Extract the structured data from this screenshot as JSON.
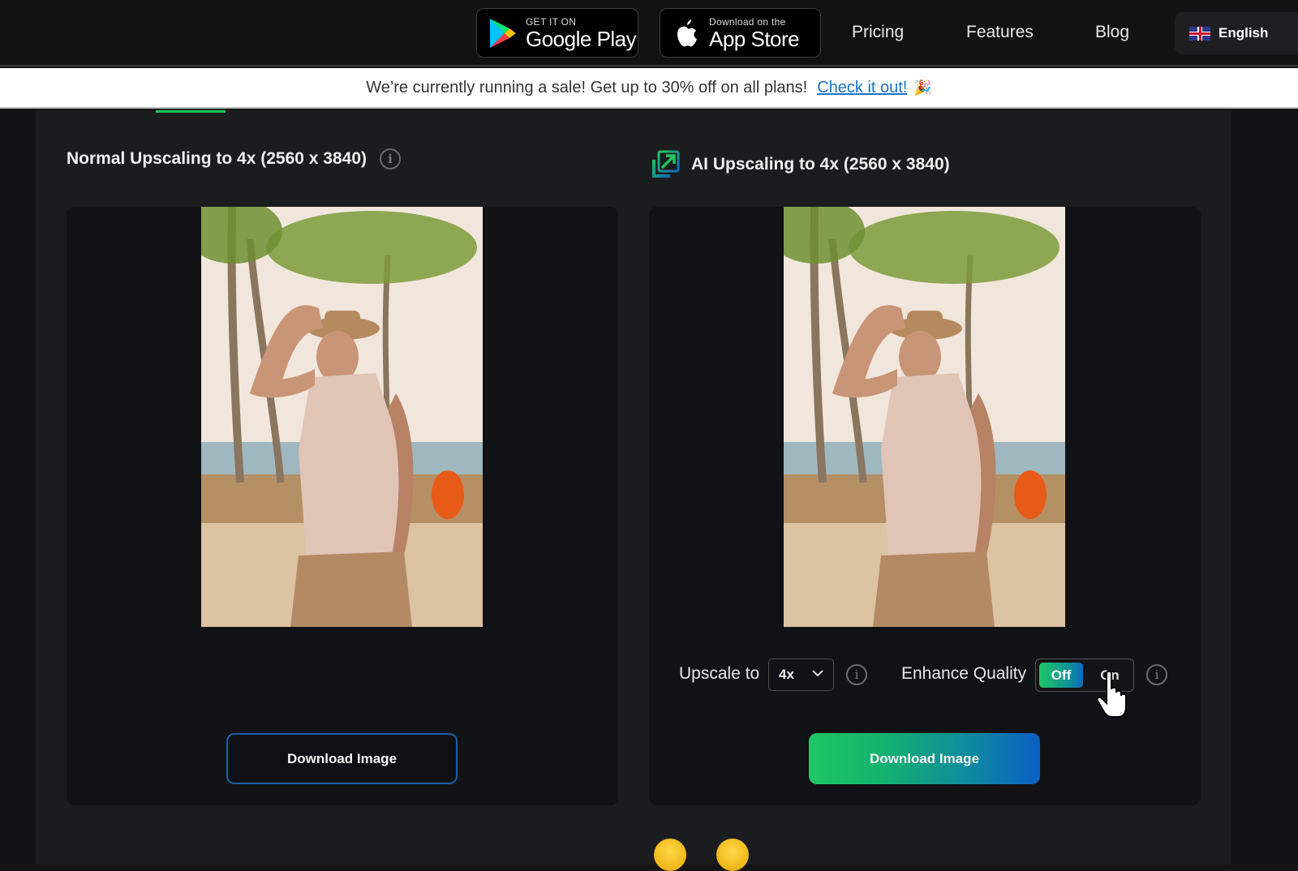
{
  "nav": {
    "google_play": {
      "small": "GET IT ON",
      "big": "Google Play",
      "icon": "google-play-icon"
    },
    "app_store": {
      "small": "Download on the",
      "big": "App Store",
      "icon": "apple-icon"
    },
    "links": [
      "Pricing",
      "Features",
      "Blog"
    ],
    "language": {
      "label": "English",
      "icon": "uk-flag-icon"
    }
  },
  "banner": {
    "text": "We’re currently running a sale! Get up to 30% off on all plans!",
    "link": "Check it out!",
    "emoji": "🎉"
  },
  "left": {
    "title": "Normal Upscaling to 4x (2560 x 3840)",
    "info_icon": "i",
    "download_label": "Download Image"
  },
  "right": {
    "title": "AI Upscaling to 4x (2560 x 3840)",
    "download_label": "Download Image",
    "upscale_label": "Upscale to",
    "upscale_value": "4x",
    "enhance_label": "Enhance Quality",
    "toggle_off": "Off",
    "toggle_on": "On",
    "toggle_state": "Off",
    "info_icon": "i"
  },
  "colors": {
    "accent_green": "#22c55e",
    "accent_blue": "#0b5fc4",
    "link_blue": "#1a73c8"
  }
}
